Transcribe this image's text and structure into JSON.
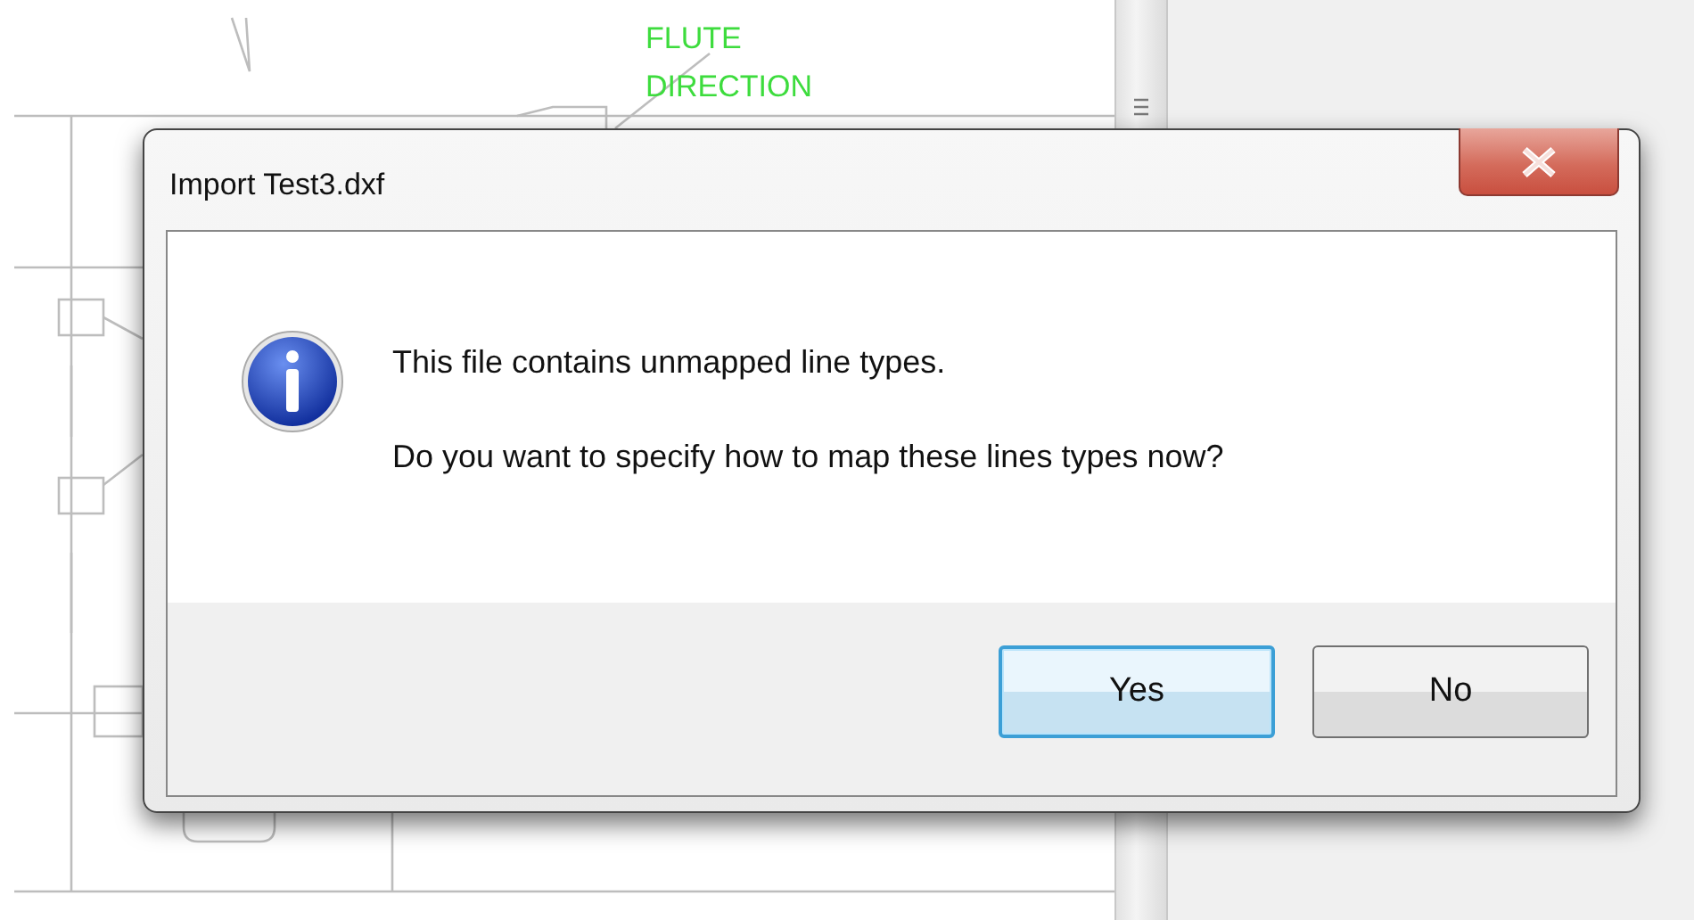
{
  "drawing": {
    "annotation_lines": [
      "FLUTE",
      "DIRECTION"
    ]
  },
  "dialog": {
    "title": "Import Test3.dxf",
    "message_lines": [
      "This file contains unmapped line types.",
      "Do you want to specify how to map these lines types now?"
    ],
    "buttons": [
      {
        "label": "Yes",
        "default": true
      },
      {
        "label": "No",
        "default": false
      }
    ]
  }
}
